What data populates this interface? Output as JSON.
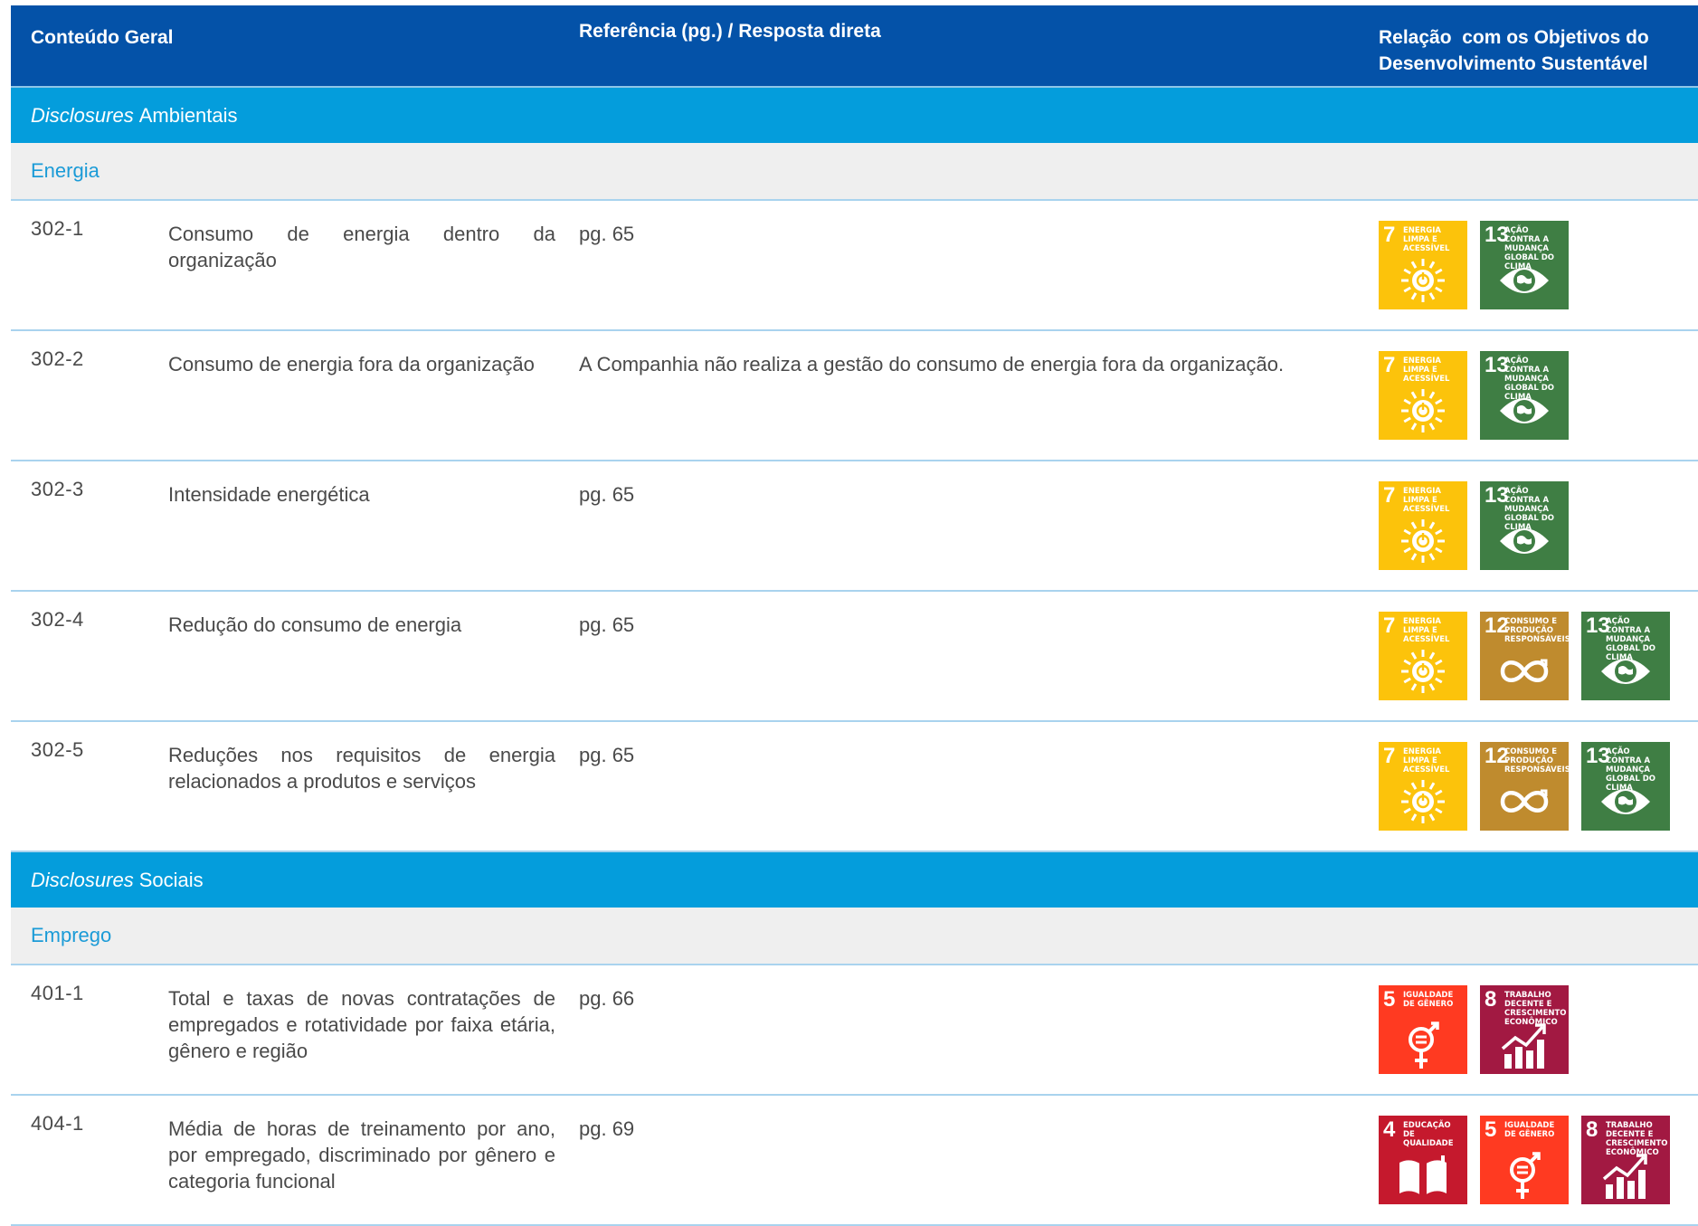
{
  "header": {
    "col1": "Conteúdo Geral",
    "col2": "Referência (pg.) / Resposta direta",
    "col3_line1": "Relação  com os Objetivos do",
    "col3_line2": "Desenvolvimento Sustentável"
  },
  "sdg_catalog": {
    "4": {
      "number": "4",
      "label": "EDUCAÇÃO DE QUALIDADE",
      "color": "#c5192d",
      "icon": "book-icon"
    },
    "5": {
      "number": "5",
      "label": "IGUALDADE DE GÊNERO",
      "color": "#ff3a21",
      "icon": "gender-equality-icon"
    },
    "7": {
      "number": "7",
      "label": "ENERGIA LIMPA E ACESSÍVEL",
      "color": "#fcc30b",
      "icon": "sun-power-icon"
    },
    "8": {
      "number": "8",
      "label": "TRABALHO DECENTE E CRESCIMENTO ECONÔMICO",
      "color": "#a21942",
      "icon": "growth-chart-icon"
    },
    "12": {
      "number": "12",
      "label": "CONSUMO E PRODUÇÃO RESPONSÁVEIS",
      "color": "#bf8b2e",
      "icon": "infinity-icon"
    },
    "13": {
      "number": "13",
      "label": "AÇÃO CONTRA A MUDANÇA GLOBAL DO CLIMA",
      "color": "#3f7e44",
      "icon": "eye-globe-icon"
    }
  },
  "sections": [
    {
      "title_italic": "Disclosures",
      "title_rest": "Ambientais",
      "subsection": "Energia",
      "rows": [
        {
          "code": "302-1",
          "description": "Consumo de energia dentro da organização",
          "reference": "pg. 65",
          "sdgs": [
            "7",
            "13"
          ]
        },
        {
          "code": "302-2",
          "description": "Consumo de energia fora da organização",
          "reference": "A Companhia não realiza a gestão do consumo de energia fora da organização.",
          "sdgs": [
            "7",
            "13"
          ]
        },
        {
          "code": "302-3",
          "description": "Intensidade energética",
          "reference": "pg. 65",
          "sdgs": [
            "7",
            "13"
          ]
        },
        {
          "code": "302-4",
          "description": "Redução do consumo de energia",
          "reference": "pg. 65",
          "sdgs": [
            "7",
            "12",
            "13"
          ]
        },
        {
          "code": "302-5",
          "description": "Reduções nos requisitos de energia relacionados a produtos e serviços",
          "reference": "pg. 65",
          "sdgs": [
            "7",
            "12",
            "13"
          ]
        }
      ]
    },
    {
      "title_italic": "Disclosures",
      "title_rest": "Sociais",
      "subsection": "Emprego",
      "rows": [
        {
          "code": "401-1",
          "description": "Total e taxas de novas contratações de empregados e rotatividade por faixa etária, gênero e região",
          "reference": "pg. 66",
          "sdgs": [
            "5",
            "8"
          ]
        },
        {
          "code": "404-1",
          "description": "Média de horas de treinamento por ano, por empregado, discriminado por gênero e categoria funcional",
          "reference": "pg. 69",
          "sdgs": [
            "4",
            "5",
            "8"
          ]
        }
      ]
    }
  ]
}
